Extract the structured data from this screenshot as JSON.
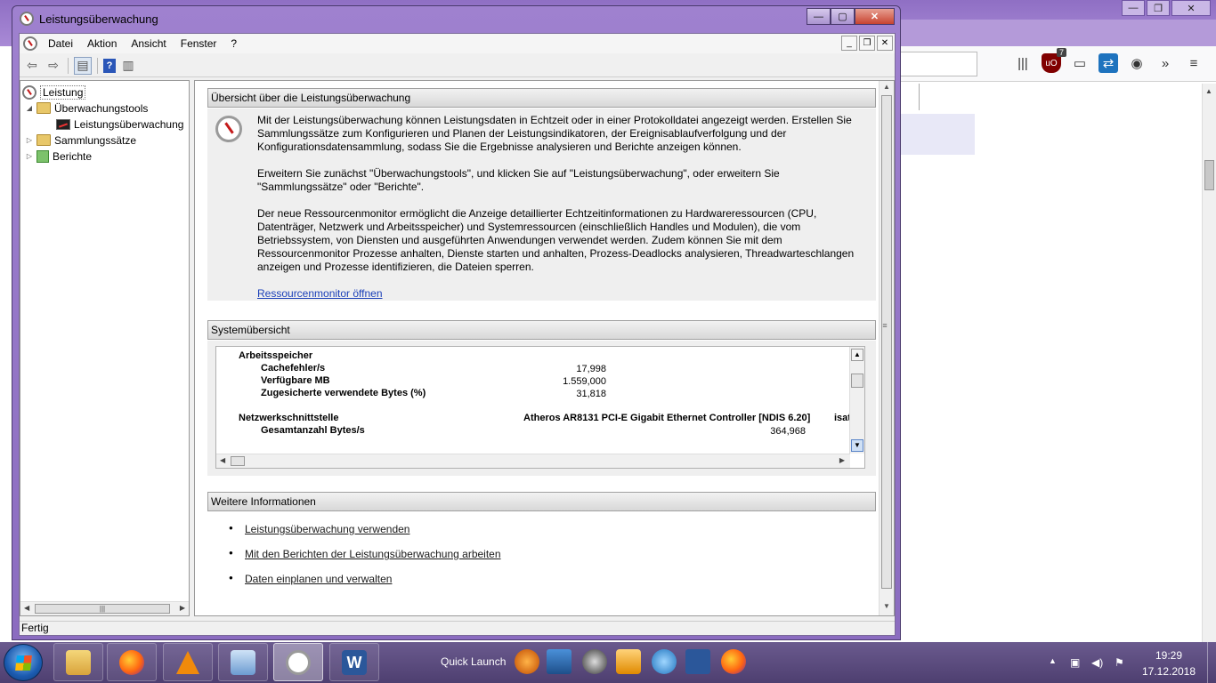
{
  "window": {
    "title": "Leistungsüberwachung"
  },
  "menu": [
    "Datei",
    "Aktion",
    "Ansicht",
    "Fenster",
    "?"
  ],
  "tree": {
    "root": "Leistung",
    "monitoring_tools": "Überwachungstools",
    "perf_monitor": "Leistungsüberwachung",
    "data_collector_sets": "Sammlungssätze",
    "reports": "Berichte"
  },
  "overview": {
    "heading": "Übersicht über die Leistungsüberwachung",
    "p1": "Mit der Leistungsüberwachung können Leistungsdaten in Echtzeit oder in einer Protokolldatei angezeigt werden. Erstellen Sie Sammlungssätze zum Konfigurieren und Planen der Leistungsindikatoren, der Ereignisablaufverfolgung und der Konfigurationsdatensammlung, sodass Sie die Ergebnisse analysieren und Berichte anzeigen können.",
    "p2": "Erweitern Sie zunächst \"Überwachungstools\", und klicken Sie auf \"Leistungsüberwachung\", oder erweitern Sie \"Sammlungssätze\" oder \"Berichte\".",
    "p3": "Der neue Ressourcenmonitor ermöglicht die Anzeige detaillierter Echtzeitinformationen zu Hardwareressourcen (CPU, Datenträger, Netzwerk und Arbeitsspeicher) und Systemressourcen (einschließlich Handles und Modulen), die vom Betriebssystem, von Diensten und ausgeführten Anwendungen verwendet werden. Zudem können Sie mit dem Ressourcenmonitor Prozesse anhalten, Dienste starten und anhalten, Prozess-Deadlocks analysieren, Threadwarteschlangen anzeigen und Prozesse identifizieren, die Dateien sperren.",
    "link": "Ressourcenmonitor öffnen"
  },
  "system": {
    "heading": "Systemübersicht",
    "memory_label": "Arbeitsspeicher",
    "rows": [
      {
        "label": "Cachefehler/s",
        "value": "17,998"
      },
      {
        "label": "Verfügbare MB",
        "value": "1.559,000"
      },
      {
        "label": "Zugesicherte verwendete Bytes (%)",
        "value": "31,818"
      }
    ],
    "net_label": "Netzwerkschnittstelle",
    "net_adapter": "Atheros AR8131 PCI-E Gigabit Ethernet Controller [NDIS 6.20]",
    "net_extra": "isat",
    "net_total_label": "Gesamtanzahl Bytes/s",
    "net_total_value": "364,968"
  },
  "more": {
    "heading": "Weitere Informationen",
    "links": [
      "Leistungsüberwachung verwenden",
      "Mit den Berichten der Leistungsüberwachung arbeiten",
      "Daten einplanen und verwalten"
    ]
  },
  "status": "Fertig",
  "taskbar": {
    "quick_launch": "Quick Launch",
    "time": "19:29",
    "date": "17.12.2018"
  }
}
